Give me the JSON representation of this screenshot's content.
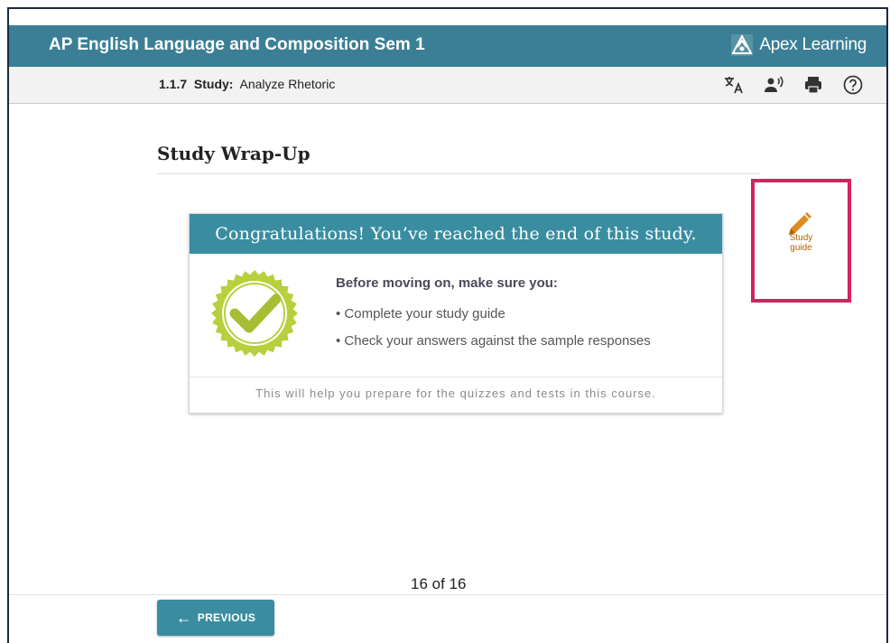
{
  "header": {
    "course_title": "AP English Language and Composition Sem 1",
    "brand": "Apex Learning",
    "brand_color": "#3a7f95"
  },
  "subheader": {
    "lesson_number": "1.1.7",
    "lesson_type": "Study:",
    "lesson_title": "Analyze Rhetoric",
    "tools": [
      {
        "icon": "translate-icon"
      },
      {
        "icon": "read-aloud-icon"
      },
      {
        "icon": "print-icon"
      },
      {
        "icon": "help-icon"
      }
    ]
  },
  "main": {
    "section_title": "Study Wrap-Up",
    "card": {
      "header": "Congratulations! You’ve reached the end of this study.",
      "lead": "Before moving on, make sure you:",
      "bullets": [
        "• Complete your study guide",
        "• Check your answers against the sample responses"
      ],
      "footer": "This will help you prepare for the quizzes and tests in this course.",
      "badge_color": "#b8cf3e"
    },
    "study_guide": {
      "icon": "pencil-icon",
      "line1": "Study",
      "line2": "guide",
      "highlight_color": "#d6215e"
    }
  },
  "footer": {
    "previous_label": "PREVIOUS",
    "pager": "16 of 16"
  }
}
